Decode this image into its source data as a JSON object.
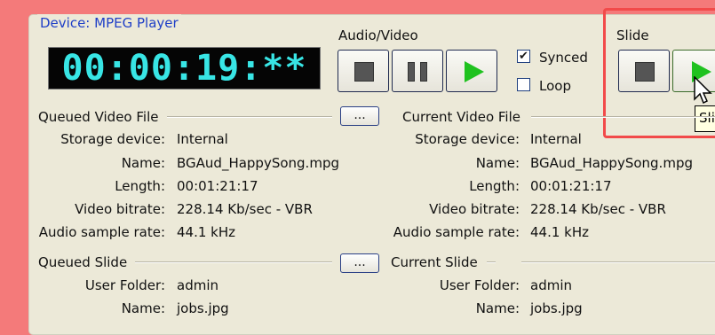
{
  "device": {
    "title": "Device: MPEG Player"
  },
  "timecode": "00:00:19:**",
  "audio_video": {
    "label": "Audio/Video"
  },
  "slide": {
    "label": "Slide",
    "tooltip": "Sli"
  },
  "options": {
    "synced_label": "Synced",
    "synced_checked": true,
    "loop_label": "Loop",
    "loop_checked": false
  },
  "queued_video": {
    "title": "Queued Video File",
    "browse_label": "...",
    "rows": [
      {
        "label": "Storage device:",
        "value": "Internal"
      },
      {
        "label": "Name:",
        "value": "BGAud_HappySong.mpg"
      },
      {
        "label": "Length:",
        "value": "00:01:21:17"
      },
      {
        "label": "Video bitrate:",
        "value": "228.14 Kb/sec - VBR"
      },
      {
        "label": "Audio sample rate:",
        "value": "44.1 kHz"
      }
    ]
  },
  "current_video": {
    "title": "Current Video File",
    "rows": [
      {
        "label": "Storage device:",
        "value": "Internal"
      },
      {
        "label": "Name:",
        "value": "BGAud_HappySong.mpg"
      },
      {
        "label": "Length:",
        "value": "00:01:21:17"
      },
      {
        "label": "Video bitrate:",
        "value": "228.14 Kb/sec - VBR"
      },
      {
        "label": "Audio sample rate:",
        "value": "44.1 kHz"
      }
    ]
  },
  "queued_slide": {
    "title": "Queued Slide",
    "browse_label": "...",
    "rows": [
      {
        "label": "User Folder:",
        "value": "admin"
      },
      {
        "label": "Name:",
        "value": "jobs.jpg"
      }
    ]
  },
  "current_slide": {
    "title": "Current Slide",
    "rows": [
      {
        "label": "User Folder:",
        "value": "admin"
      },
      {
        "label": "Name:",
        "value": "jobs.jpg"
      }
    ]
  }
}
